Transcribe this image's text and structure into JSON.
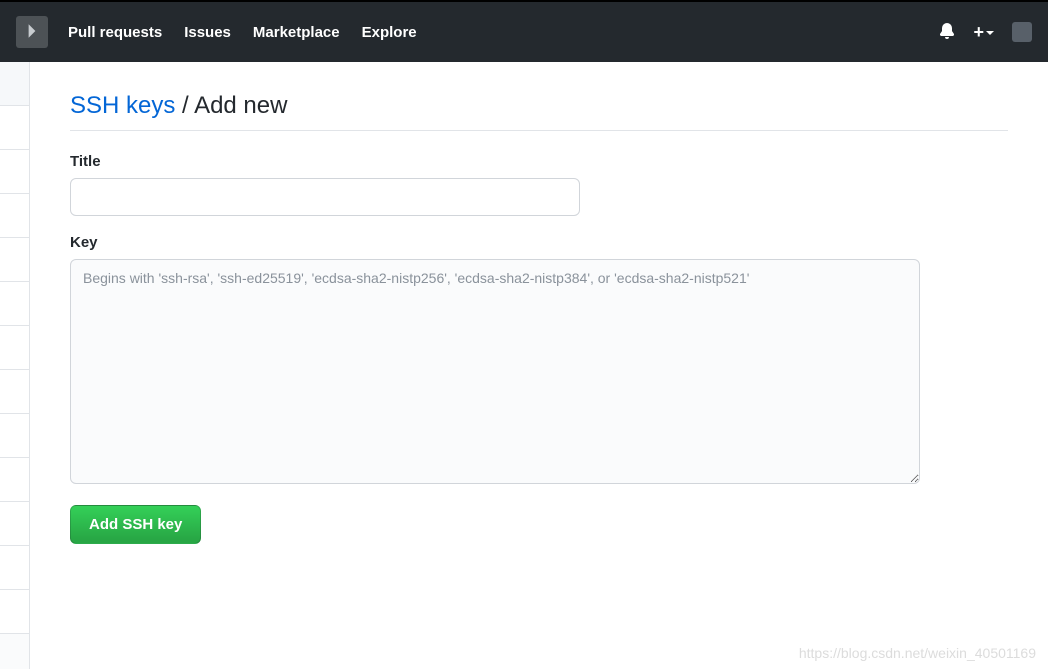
{
  "header": {
    "nav": {
      "pull_requests": "Pull requests",
      "issues": "Issues",
      "marketplace": "Marketplace",
      "explore": "Explore"
    }
  },
  "page": {
    "breadcrumb_link": "SSH keys",
    "breadcrumb_separator": " / ",
    "breadcrumb_current": "Add new"
  },
  "form": {
    "title_label": "Title",
    "title_value": "",
    "key_label": "Key",
    "key_value": "",
    "key_placeholder": "Begins with 'ssh-rsa', 'ssh-ed25519', 'ecdsa-sha2-nistp256', 'ecdsa-sha2-nistp384', or 'ecdsa-sha2-nistp521'",
    "submit_label": "Add SSH key"
  },
  "watermark": "https://blog.csdn.net/weixin_40501169"
}
